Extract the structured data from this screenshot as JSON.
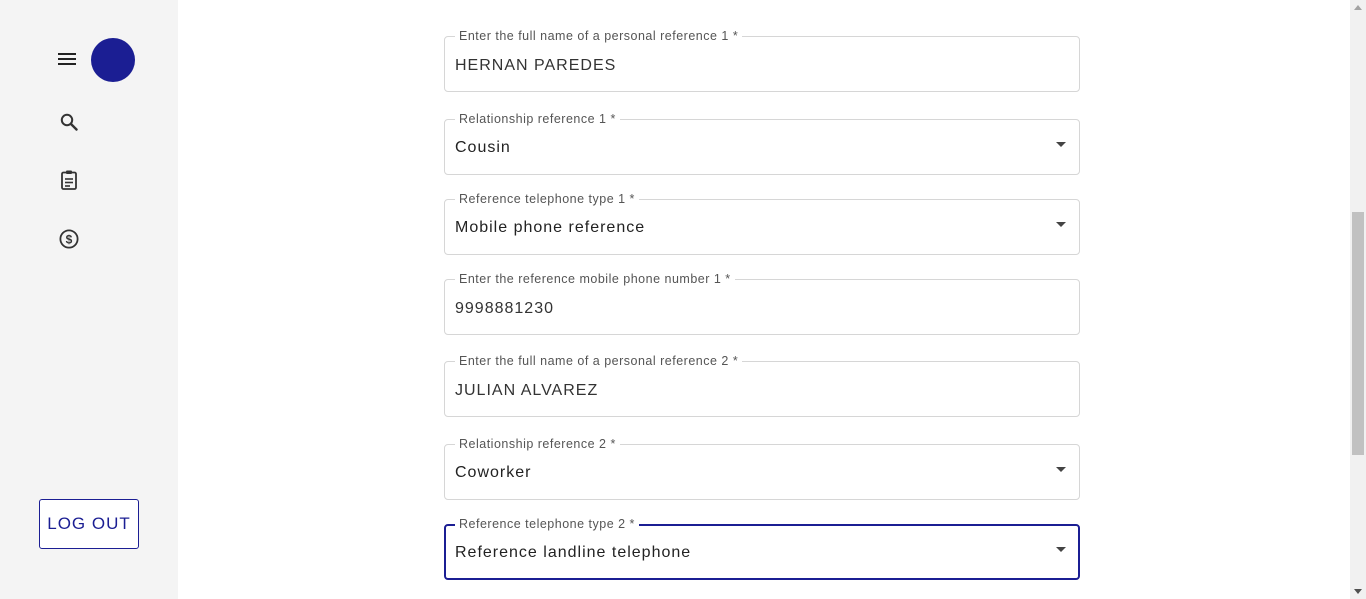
{
  "sidebar": {
    "menu_icon": "menu-icon",
    "avatar_color": "#1b1e93",
    "nav_items": [
      {
        "icon": "search-icon"
      },
      {
        "icon": "clipboard-icon"
      },
      {
        "icon": "dollar-circle-icon"
      }
    ],
    "logout_label": "LOG OUT"
  },
  "form": {
    "fields": [
      {
        "label": "Enter the full name of a personal reference 1 *",
        "value": "HERNAN PAREDES",
        "type": "text"
      },
      {
        "label": "Relationship reference 1 *",
        "value": "Cousin",
        "type": "select"
      },
      {
        "label": "Reference telephone type 1 *",
        "value": "Mobile phone reference",
        "type": "select"
      },
      {
        "label": "Enter the reference mobile phone number 1 *",
        "value": "9998881230",
        "type": "text"
      },
      {
        "label": "Enter the full name of a personal reference 2 *",
        "value": "JULIAN ALVAREZ",
        "type": "text"
      },
      {
        "label": "Relationship reference 2 *",
        "value": "Coworker",
        "type": "select"
      },
      {
        "label": "Reference telephone type 2 *",
        "value": "Reference landline telephone",
        "type": "select",
        "focused": true
      }
    ]
  },
  "colors": {
    "accent": "#1b1e93",
    "sidebar_bg": "#f4f4f4",
    "border": "#d6d6d6"
  }
}
